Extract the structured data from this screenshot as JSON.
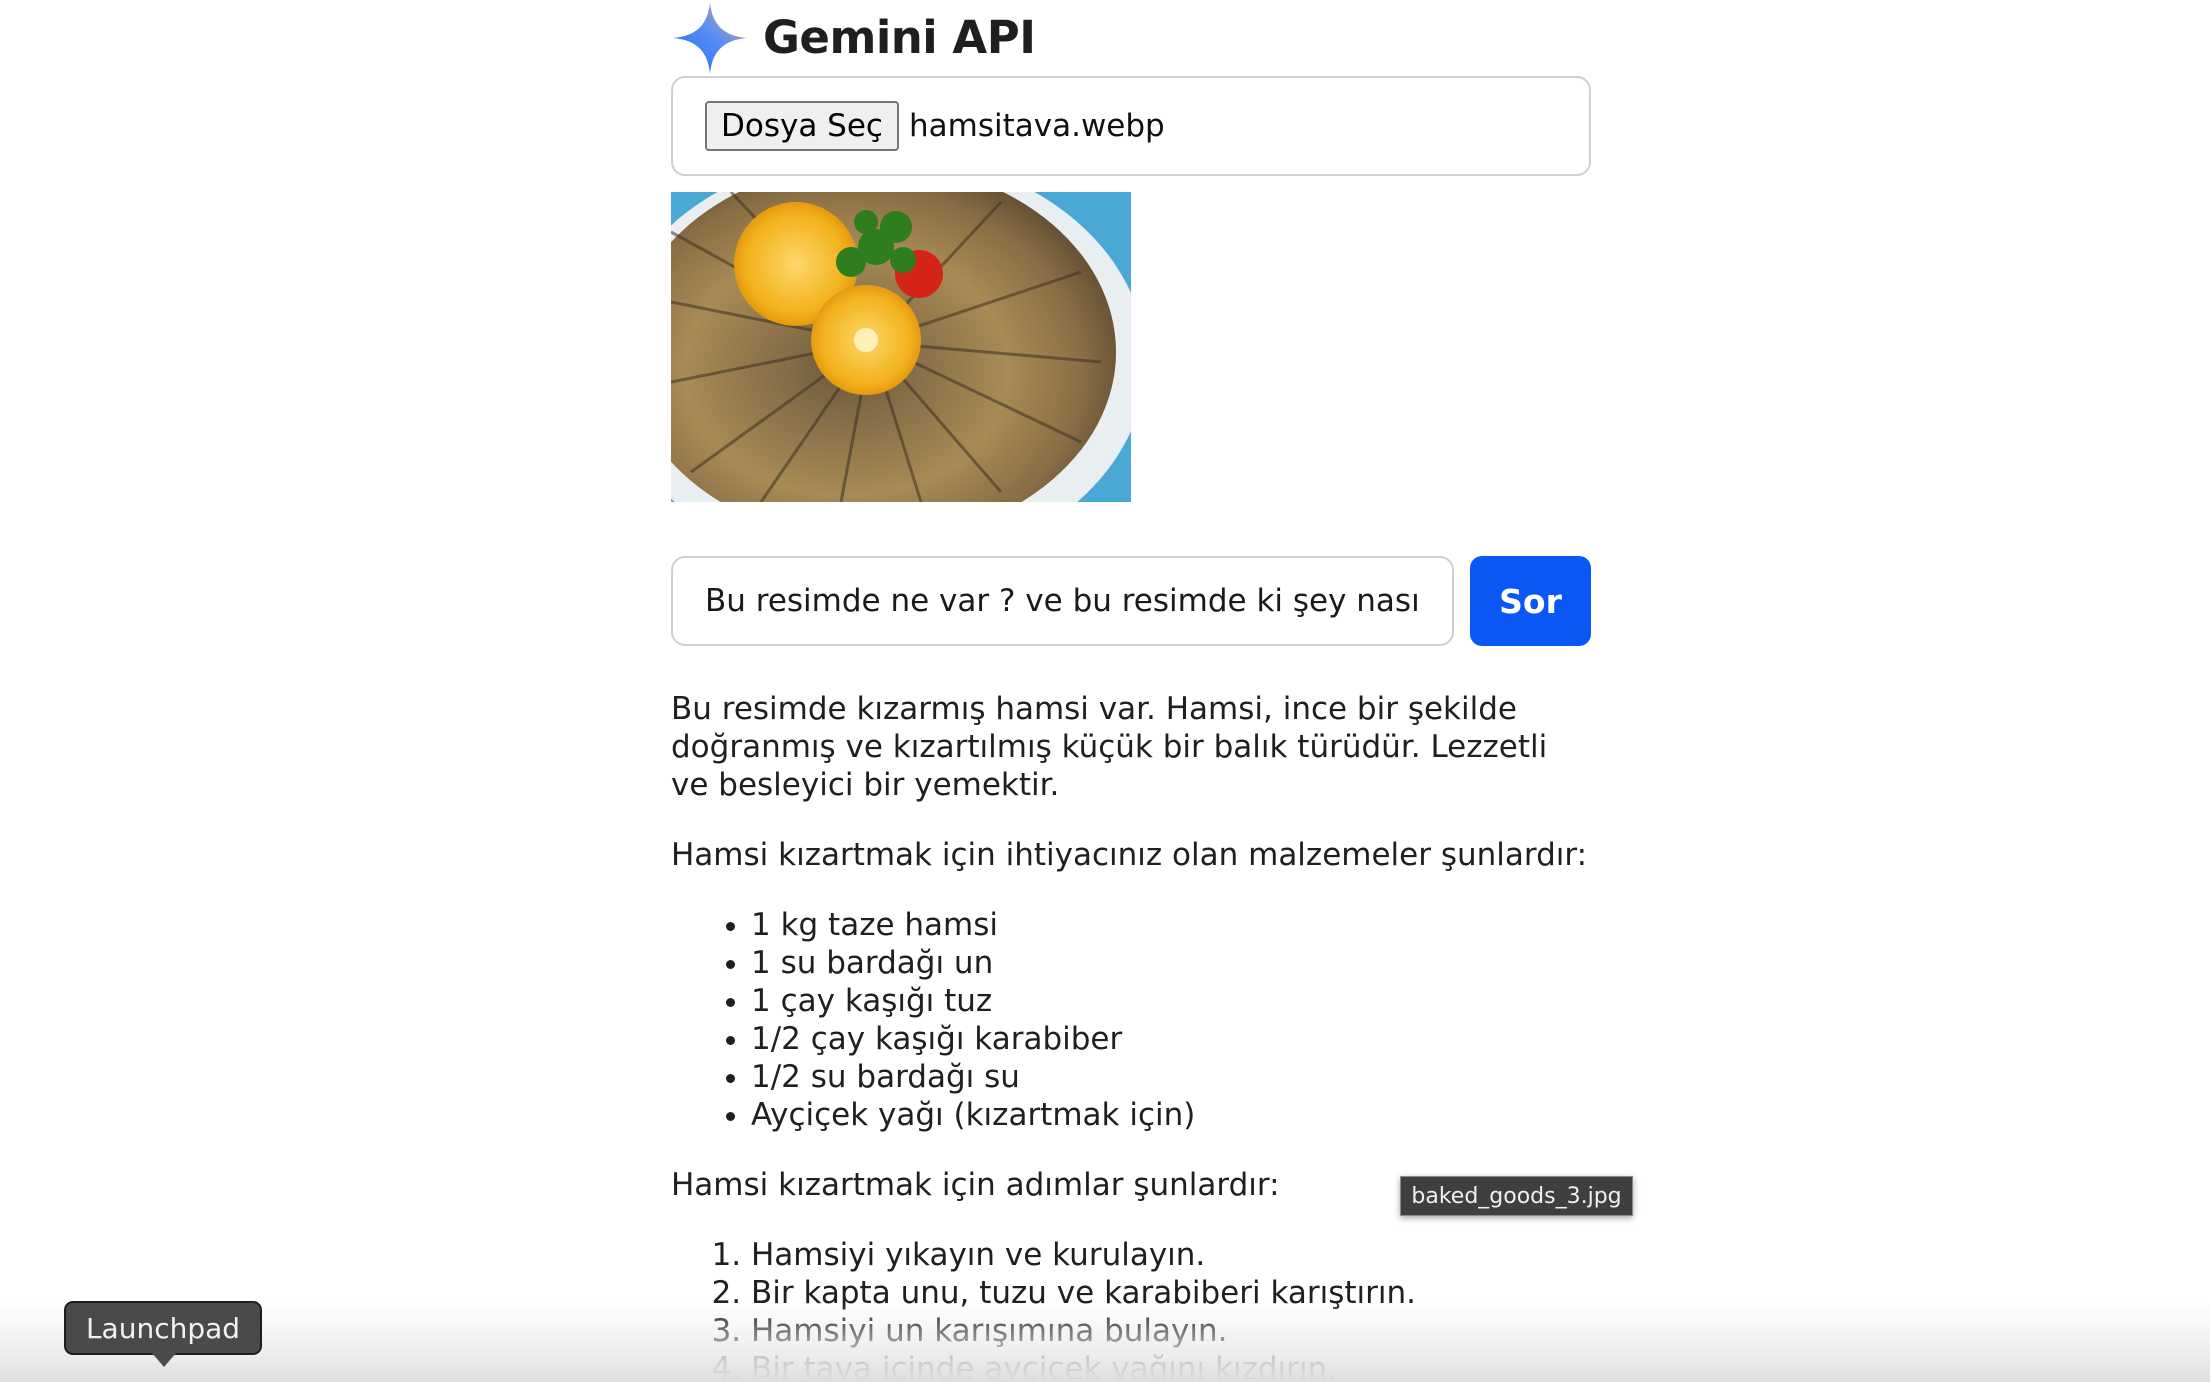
{
  "header": {
    "title": "Gemini API",
    "logo_icon": "gemini-sparkle-icon"
  },
  "file_picker": {
    "button_label": "Dosya Seç",
    "file_name": "hamsitava.webp"
  },
  "preview": {
    "subject": "fried anchovies with lemon, parsley and tomato"
  },
  "prompt": {
    "value": "Bu resimde ne var ? ve bu resimde ki şey nasıl yapılır",
    "button_label": "Sor"
  },
  "answer": {
    "intro": "Bu resimde kızarmış hamsi var. Hamsi, ince bir şekilde doğranmış ve kızartılmış küçük bir balık türüdür. Lezzetli ve besleyici bir yemektir.",
    "ingredients_heading": "Hamsi kızartmak için ihtiyacınız olan malzemeler şunlardır:",
    "ingredients": [
      "1 kg taze hamsi",
      "1 su bardağı un",
      "1 çay kaşığı tuz",
      "1/2 çay kaşığı karabiber",
      "1/2 su bardağı su",
      "Ayçiçek yağı (kızartmak için)"
    ],
    "steps_heading": "Hamsi kızartmak için adımlar şunlardır:",
    "steps": [
      "Hamsiyi yıkayın ve kurulayın.",
      "Bir kapta unu, tuzu ve karabiberi karıştırın.",
      "Hamsiyi un karışımına bulayın.",
      "Bir tava içinde ayçiçek yağını kızdırın."
    ]
  },
  "tooltips": {
    "file_drag": "baked_goods_3.jpg",
    "dock": "Launchpad"
  },
  "colors": {
    "accent": "#0b57f5",
    "border": "#cfcfcf",
    "text": "#1f1f1f"
  }
}
